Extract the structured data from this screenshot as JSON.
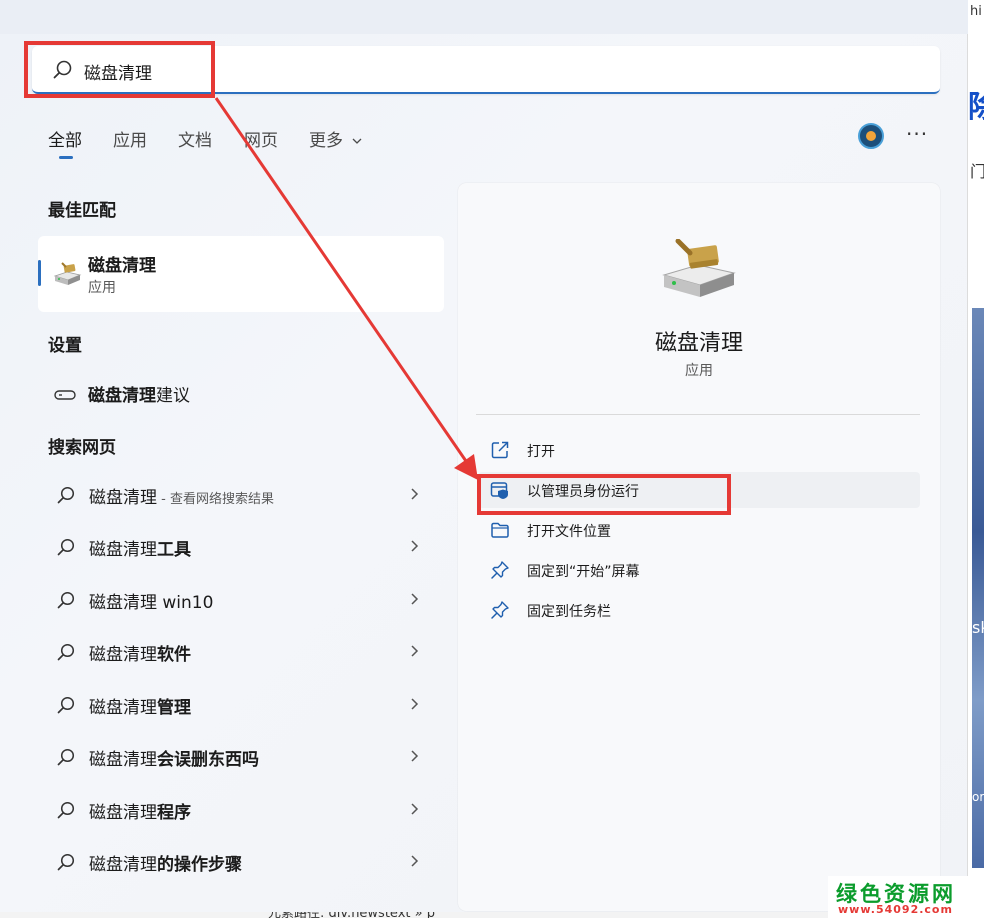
{
  "search": {
    "query": "磁盘清理"
  },
  "tabs": [
    {
      "label": "全部",
      "active": true
    },
    {
      "label": "应用"
    },
    {
      "label": "文档"
    },
    {
      "label": "网页"
    },
    {
      "label": "更多"
    }
  ],
  "sections": {
    "best_match": "最佳匹配",
    "settings": "设置",
    "web": "搜索网页"
  },
  "best_match": {
    "title": "磁盘清理",
    "subtitle": "应用"
  },
  "settings_item": {
    "prefix": "磁盘清理",
    "suffix": "建议"
  },
  "web_results": [
    {
      "prefix": "磁盘清理",
      "suffix": "",
      "hint": " - 查看网络搜索结果"
    },
    {
      "prefix": "磁盘清理",
      "suffix": "工具",
      "hint": ""
    },
    {
      "prefix": "磁盘清理 win10",
      "suffix": "",
      "hint": ""
    },
    {
      "prefix": "磁盘清理",
      "suffix": "软件",
      "hint": ""
    },
    {
      "prefix": "磁盘清理",
      "suffix": "管理",
      "hint": ""
    },
    {
      "prefix": "磁盘清理",
      "suffix": "会误删东西吗",
      "hint": ""
    },
    {
      "prefix": "磁盘清理",
      "suffix": "程序",
      "hint": ""
    },
    {
      "prefix": "磁盘清理",
      "suffix": "的操作步骤",
      "hint": ""
    }
  ],
  "detail": {
    "title": "磁盘清理",
    "subtitle": "应用",
    "actions": [
      {
        "label": "打开",
        "icon": "open-external-icon"
      },
      {
        "label": "以管理员身份运行",
        "icon": "shield-admin-icon"
      },
      {
        "label": "打开文件位置",
        "icon": "folder-icon"
      },
      {
        "label": "固定到“开始”屏幕",
        "icon": "pin-icon"
      },
      {
        "label": "固定到任务栏",
        "icon": "pin-icon"
      }
    ]
  },
  "background": {
    "frag_hi": "hi",
    "frag_blue": "除",
    "frag_men": "门",
    "frag_sk": "sk",
    "frag_or": "or",
    "bottom_text": "元素路径: div.newstext » p"
  },
  "watermark": {
    "top": "绿色资源网",
    "bottom": "www.54092.com"
  },
  "colors": {
    "accent": "#2b6fbf",
    "annotation_red": "#e53935",
    "watermark_green": "#0b9c2c"
  }
}
